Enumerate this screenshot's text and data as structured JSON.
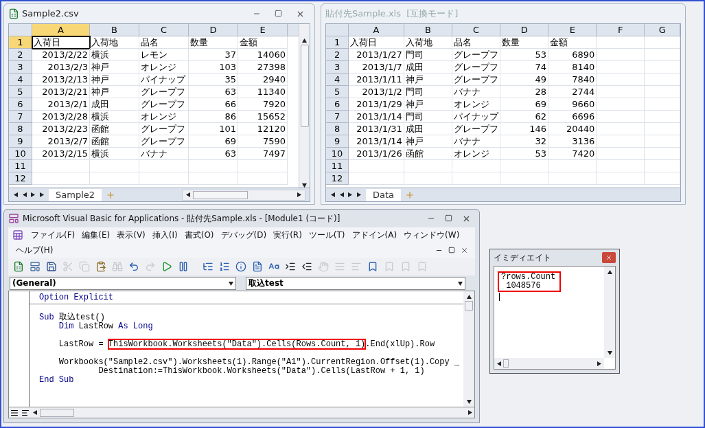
{
  "left_window": {
    "title": "Sample2.csv",
    "active": true,
    "columns": [
      {
        "label": "A",
        "selected": true,
        "numeric": true
      },
      {
        "label": "B",
        "selected": false,
        "numeric": false
      },
      {
        "label": "C",
        "selected": false,
        "numeric": false
      },
      {
        "label": "D",
        "selected": false,
        "numeric": true
      },
      {
        "label": "E",
        "selected": false,
        "numeric": true
      }
    ],
    "row_numbers": [
      {
        "label": "1",
        "selected": true
      },
      {
        "label": "2",
        "selected": false
      },
      {
        "label": "3",
        "selected": false
      },
      {
        "label": "4",
        "selected": false
      },
      {
        "label": "5",
        "selected": false
      },
      {
        "label": "6",
        "selected": false
      },
      {
        "label": "7",
        "selected": false
      },
      {
        "label": "8",
        "selected": false
      },
      {
        "label": "9",
        "selected": false
      },
      {
        "label": "10",
        "selected": false
      },
      {
        "label": "11",
        "selected": false
      },
      {
        "label": "12",
        "selected": false
      }
    ],
    "header_row": [
      "入荷日",
      "入荷地",
      "品名",
      "数量",
      "金額"
    ],
    "rows": [
      [
        "2013/2/22",
        "横浜",
        "レモン",
        "37",
        "14060"
      ],
      [
        "2013/2/3",
        "神戸",
        "オレンジ",
        "103",
        "27398"
      ],
      [
        "2013/2/13",
        "神戸",
        "パイナップ",
        "35",
        "2940"
      ],
      [
        "2013/2/21",
        "神戸",
        "グレープフ",
        "63",
        "11340"
      ],
      [
        "2013/2/1",
        "成田",
        "グレープフ",
        "66",
        "7920"
      ],
      [
        "2013/2/28",
        "横浜",
        "オレンジ",
        "86",
        "15652"
      ],
      [
        "2013/2/23",
        "函館",
        "グレープフ",
        "101",
        "12120"
      ],
      [
        "2013/2/7",
        "函館",
        "グレープフ",
        "69",
        "7590"
      ],
      [
        "2013/2/15",
        "横浜",
        "バナナ",
        "63",
        "7497"
      ]
    ],
    "tabs": [
      {
        "label": "Sample2",
        "selected": true
      }
    ]
  },
  "right_window": {
    "title": "貼付先Sample.xls  [互換モード]",
    "active": false,
    "columns": [
      {
        "label": "A",
        "selected": false,
        "numeric": true
      },
      {
        "label": "B",
        "selected": false,
        "numeric": false
      },
      {
        "label": "C",
        "selected": false,
        "numeric": false
      },
      {
        "label": "D",
        "selected": false,
        "numeric": true
      },
      {
        "label": "E",
        "selected": false,
        "numeric": true
      },
      {
        "label": "F",
        "selected": false,
        "numeric": false
      },
      {
        "label": "G",
        "selected": false,
        "numeric": false
      }
    ],
    "row_numbers": [
      {
        "label": "1",
        "selected": false
      },
      {
        "label": "2",
        "selected": false
      },
      {
        "label": "3",
        "selected": false
      },
      {
        "label": "4",
        "selected": false
      },
      {
        "label": "5",
        "selected": false
      },
      {
        "label": "6",
        "selected": false
      },
      {
        "label": "7",
        "selected": false
      },
      {
        "label": "8",
        "selected": false
      },
      {
        "label": "9",
        "selected": false
      },
      {
        "label": "10",
        "selected": false
      },
      {
        "label": "11",
        "selected": false
      },
      {
        "label": "12",
        "selected": false
      }
    ],
    "header_row": [
      "入荷日",
      "入荷地",
      "品名",
      "数量",
      "金額"
    ],
    "rows": [
      [
        "2013/1/27",
        "門司",
        "グレープフ",
        "53",
        "6890"
      ],
      [
        "2013/1/7",
        "成田",
        "グレープフ",
        "74",
        "8140"
      ],
      [
        "2013/1/11",
        "神戸",
        "グレープフ",
        "49",
        "7840"
      ],
      [
        "2013/1/2",
        "門司",
        "バナナ",
        "28",
        "2744"
      ],
      [
        "2013/1/29",
        "神戸",
        "オレンジ",
        "69",
        "9660"
      ],
      [
        "2013/1/14",
        "門司",
        "パイナップ",
        "62",
        "6696"
      ],
      [
        "2013/1/31",
        "成田",
        "グレープフ",
        "146",
        "20440"
      ],
      [
        "2013/1/14",
        "神戸",
        "バナナ",
        "32",
        "3136"
      ],
      [
        "2013/1/26",
        "函館",
        "オレンジ",
        "53",
        "7420"
      ]
    ],
    "tabs": [
      {
        "label": "Data",
        "selected": true
      }
    ]
  },
  "vba_window": {
    "title": "Microsoft Visual Basic for Applications - 貼付先Sample.xls - [Module1 (コード)]",
    "menu": [
      "ファイル(F)",
      "編集(E)",
      "表示(V)",
      "挿入(I)",
      "書式(O)",
      "デバッグ(D)",
      "実行(R)",
      "ツール(T)",
      "アドイン(A)",
      "ウィンドウ(W)",
      "ヘルプ(H)"
    ],
    "toolbar": [
      {
        "kind": "excel",
        "disabled": false
      },
      {
        "kind": "form",
        "disabled": false
      },
      {
        "kind": "save",
        "disabled": false
      },
      {
        "kind": "cut",
        "disabled": true
      },
      {
        "kind": "copy",
        "disabled": true
      },
      {
        "kind": "paste",
        "disabled": false
      },
      {
        "kind": "find",
        "disabled": true
      },
      {
        "kind": "undo",
        "disabled": false
      },
      {
        "kind": "redo",
        "disabled": true
      },
      {
        "kind": "run",
        "disabled": false
      },
      {
        "kind": "pause",
        "disabled": false
      }
    ],
    "edit_toolbar": [
      {
        "kind": "list",
        "disabled": false
      },
      {
        "kind": "constants",
        "disabled": false
      },
      {
        "kind": "info",
        "disabled": false
      },
      {
        "kind": "params",
        "disabled": false
      },
      {
        "kind": "complete",
        "disabled": false
      },
      {
        "kind": "indent",
        "disabled": false
      },
      {
        "kind": "outdent",
        "disabled": false
      },
      {
        "kind": "breakpoint",
        "disabled": true
      },
      {
        "kind": "comment",
        "disabled": true
      },
      {
        "kind": "uncomment",
        "disabled": true
      },
      {
        "kind": "bookmark",
        "disabled": false
      },
      {
        "kind": "bookmark",
        "disabled": true
      },
      {
        "kind": "bookmark",
        "disabled": true
      },
      {
        "kind": "bookmark",
        "disabled": true
      }
    ],
    "object_dropdown": "(General)",
    "procedure_dropdown": "取込test",
    "code": [
      {
        "separator_after": true,
        "blank_before": false,
        "segments": [
          {
            "kind": "keyword",
            "text": "Option Explicit"
          }
        ]
      },
      {
        "separator_after": false,
        "blank_before": true,
        "segments": [
          {
            "kind": "keyword",
            "text": "Sub"
          },
          {
            "kind": "text",
            "text": " 取込test()"
          }
        ]
      },
      {
        "separator_after": false,
        "blank_before": false,
        "segments": [
          {
            "kind": "keyword",
            "text": "    Dim"
          },
          {
            "kind": "text",
            "text": " LastRow "
          },
          {
            "kind": "keyword",
            "text": "As Long"
          }
        ]
      },
      {
        "separator_after": false,
        "blank_before": true,
        "segments": [
          {
            "kind": "text",
            "text": "    LastRow = "
          },
          {
            "kind": "boxed",
            "text": "ThisWorkbook.Worksheets(\"Data\").Cells(Rows.Count, 1)"
          },
          {
            "kind": "text",
            "text": ".End(xlUp).Row"
          }
        ]
      },
      {
        "separator_after": false,
        "blank_before": true,
        "segments": [
          {
            "kind": "text",
            "text": "    Workbooks(\"Sample2.csv\").Worksheets(1).Range(\"A1\").CurrentRegion.Offset(1).Copy _"
          }
        ]
      },
      {
        "separator_after": false,
        "blank_before": false,
        "segments": [
          {
            "kind": "text",
            "text": "            Destination:=ThisWorkbook.Worksheets(\"Data\").Cells(LastRow + 1, 1)"
          }
        ]
      },
      {
        "separator_after": false,
        "blank_before": false,
        "segments": [
          {
            "kind": "keyword",
            "text": "End Sub"
          }
        ]
      }
    ]
  },
  "immediate_window": {
    "title": "イミディエイト",
    "lines": [
      "?rows.Count",
      " 1048576"
    ],
    "highlighted": true
  }
}
